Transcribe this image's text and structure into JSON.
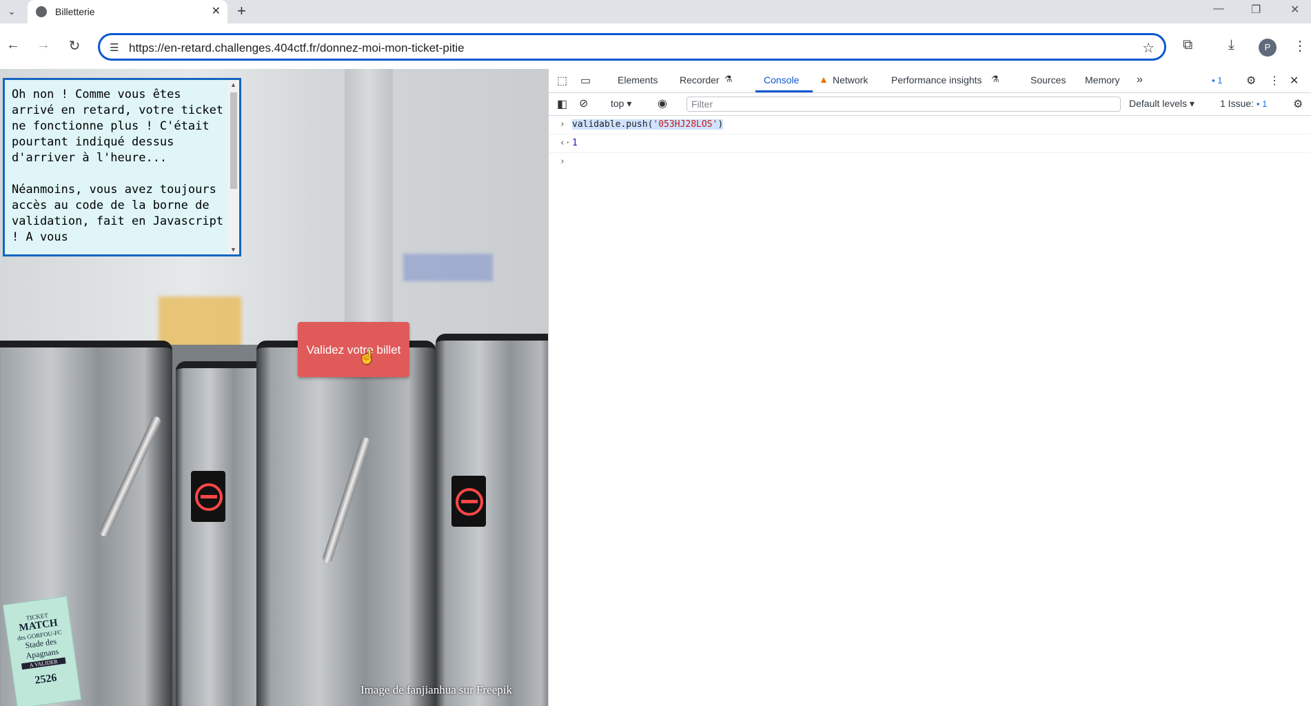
{
  "browser": {
    "tab_title": "Billetterie",
    "url": "https://en-retard.challenges.404ctf.fr/donnez-moi-mon-ticket-pitie",
    "avatar_letter": "P",
    "new_tab_symbol": "+",
    "accent_color": "#0b57d0"
  },
  "page": {
    "intro_text": "Oh non ! Comme vous êtes arrivé en retard, votre ticket ne fonctionne plus ! C'était pourtant indiqué dessus d'arriver à l'heure...\n\nNéanmoins, vous avez toujours accès au code de la borne de validation, fait en Javascript ! A vous",
    "validate_button": "Validez votre billet",
    "credit": "Image de fanjianhua sur Freepik",
    "ticket": {
      "line1": "TICKET",
      "line2": "MATCH",
      "line3": "des GORFOU-FC",
      "line4": "Stade des Apagnans",
      "line5": "A VALIDER",
      "number": "2526"
    },
    "button_color": "#e05a5a",
    "textbox_bg": "#dff5f7"
  },
  "devtools": {
    "tabs": [
      "Elements",
      "Recorder",
      "Console",
      "Network",
      "Performance insights",
      "Sources",
      "Memory"
    ],
    "active_tab": "Console",
    "messages_badge": "1",
    "context": "top",
    "filter_placeholder": "Filter",
    "levels": "Default levels",
    "issues_label": "1 Issue:",
    "issues_count": "1",
    "console": {
      "input_command_prefix": "validable.push(",
      "input_command_string": "'053HJ28LOS'",
      "input_command_suffix": ")",
      "result": "1"
    }
  }
}
